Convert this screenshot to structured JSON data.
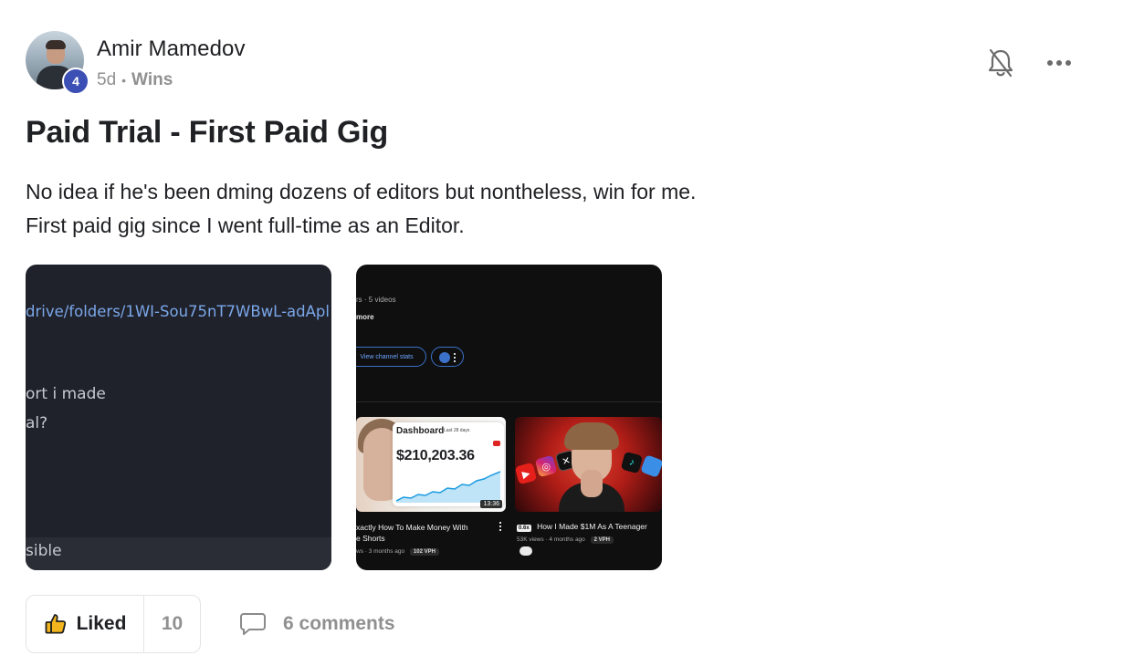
{
  "post": {
    "author": "Amir Mamedov",
    "level": "4",
    "time_ago": "5d",
    "separator": "•",
    "category": "Wins",
    "title": "Paid Trial - First Paid Gig",
    "body_lines": [
      "No idea if he's been dming dozens of editors but nontheless, win for me.",
      "First paid gig since I went full-time as an Editor."
    ]
  },
  "attachments": {
    "image1": {
      "link_text": "drive/folders/1WI-Sou75nT7WBwL-adApl",
      "line1": "ort i made",
      "line2": "al?",
      "line3": "sible"
    },
    "image2": {
      "channel_stats": "rs · 5 videos",
      "more_label": "more",
      "view_stats_button": "View channel stats",
      "video1": {
        "dashboard_title": "Dashboard",
        "date_range": "Last 28 days",
        "revenue": "$210,203.36",
        "duration": "13:36",
        "caption_line1": "xactly How To Make Money With",
        "caption_line2": "e Shorts",
        "meta": "ws · 3 months ago",
        "vph": "102 VPH"
      },
      "video2": {
        "multiplier": "0.6x",
        "caption": "How I Made $1M As A Teenager",
        "meta": "53K views · 4 months ago",
        "vph": "2 VPH"
      }
    }
  },
  "actions": {
    "like_label": "Liked",
    "like_count": "10",
    "comments_label": "6 comments"
  },
  "colors": {
    "level_badge": "#3c4fb5",
    "like_icon": "#f2b51d",
    "muted_text": "#909090"
  },
  "icons": {
    "notifications": "bell-off-icon",
    "menu": "more-horizontal-icon",
    "like": "thumbs-up-icon",
    "comments": "comment-bubble-icon"
  }
}
